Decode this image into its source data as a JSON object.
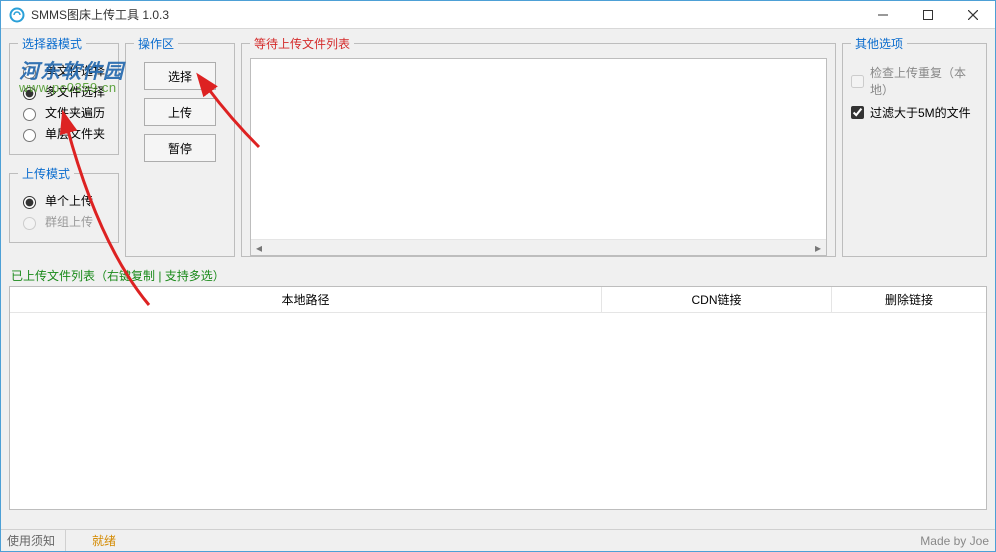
{
  "window": {
    "title": "SMMS图床上传工具 1.0.3"
  },
  "groups": {
    "select_mode": {
      "legend": "选择器模式",
      "opt_single": "单文件选择",
      "opt_multi": "多文件选择",
      "opt_folder": "文件夹遍历",
      "opt_flat_folder": "单层文件夹"
    },
    "upload_mode": {
      "legend": "上传模式",
      "opt_single": "单个上传",
      "opt_group": "群组上传"
    },
    "ops": {
      "legend": "操作区",
      "btn_select": "选择",
      "btn_upload": "上传",
      "btn_pause": "暂停"
    },
    "wait_list": {
      "legend": "等待上传文件列表"
    },
    "other": {
      "legend": "其他选项",
      "chk_dupe": "检查上传重复（本地）",
      "chk_filter": "过滤大于5M的文件"
    }
  },
  "uploaded": {
    "title": "已上传文件列表（右键复制 | 支持多选）",
    "col_path": "本地路径",
    "col_cdn": "CDN链接",
    "col_delete": "删除链接"
  },
  "status": {
    "left": "使用须知",
    "mid": "就绪",
    "right": "Made by Joe"
  },
  "watermark": {
    "line1": "河东软件园",
    "line2": "www.pc0359.cn"
  }
}
